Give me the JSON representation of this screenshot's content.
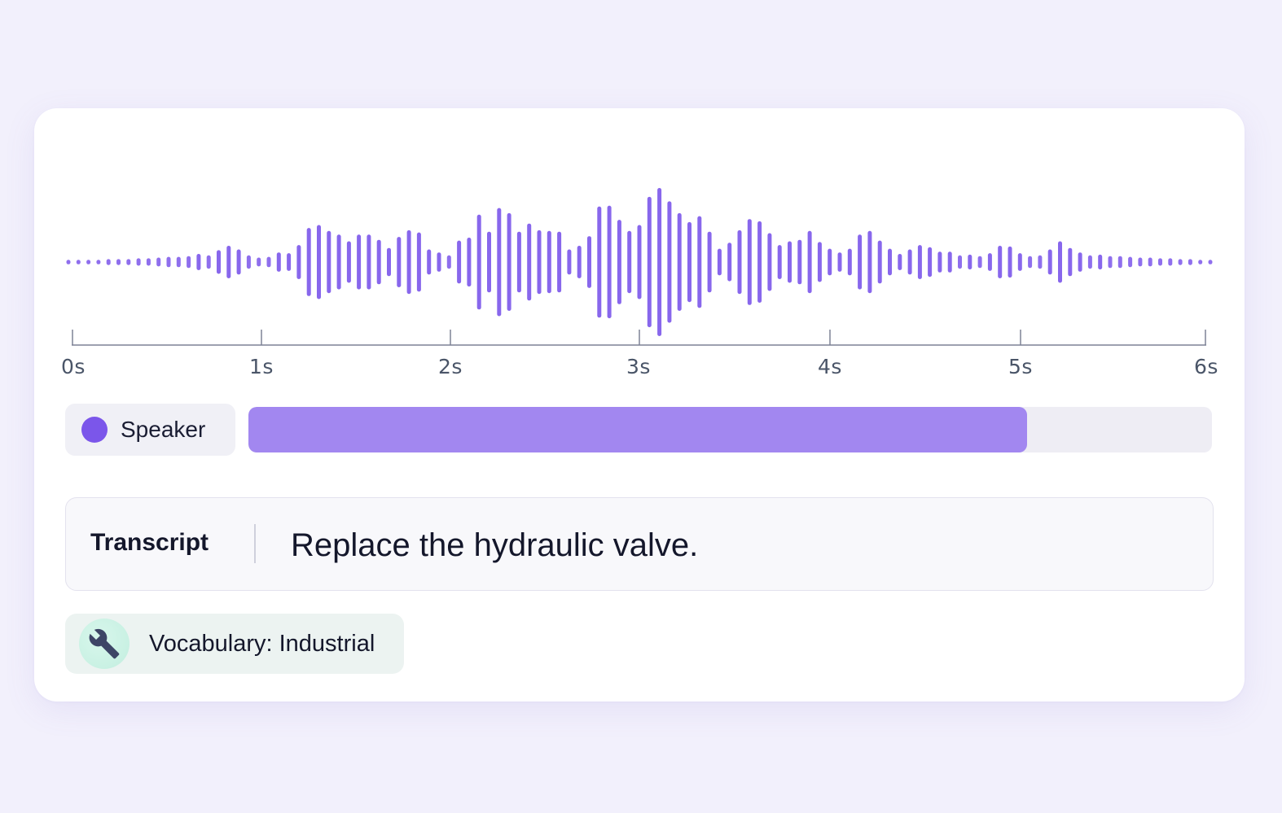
{
  "waveform": {
    "color": "#7b56ea",
    "amplitudes": [
      0.03,
      0.03,
      0.03,
      0.03,
      0.04,
      0.04,
      0.04,
      0.05,
      0.05,
      0.06,
      0.07,
      0.07,
      0.08,
      0.11,
      0.09,
      0.16,
      0.22,
      0.17,
      0.09,
      0.06,
      0.07,
      0.13,
      0.12,
      0.23,
      0.46,
      0.5,
      0.42,
      0.37,
      0.28,
      0.37,
      0.37,
      0.3,
      0.19,
      0.34,
      0.43,
      0.4,
      0.17,
      0.13,
      0.09,
      0.29,
      0.33,
      0.64,
      0.41,
      0.73,
      0.66,
      0.41,
      0.52,
      0.43,
      0.42,
      0.41,
      0.17,
      0.22,
      0.35,
      0.75,
      0.76,
      0.57,
      0.42,
      0.5,
      0.88,
      1.0,
      0.82,
      0.66,
      0.54,
      0.62,
      0.41,
      0.18,
      0.26,
      0.43,
      0.58,
      0.55,
      0.39,
      0.23,
      0.28,
      0.3,
      0.42,
      0.27,
      0.18,
      0.13,
      0.18,
      0.37,
      0.42,
      0.29,
      0.18,
      0.11,
      0.17,
      0.23,
      0.2,
      0.14,
      0.14,
      0.09,
      0.1,
      0.08,
      0.12,
      0.22,
      0.21,
      0.12,
      0.08,
      0.09,
      0.17,
      0.28,
      0.19,
      0.13,
      0.09,
      0.1,
      0.08,
      0.08,
      0.07,
      0.06,
      0.06,
      0.05,
      0.05,
      0.04,
      0.04,
      0.03,
      0.03
    ]
  },
  "timeline": {
    "ticks": [
      "0s",
      "1s",
      "2s",
      "3s",
      "4s",
      "5s",
      "6s"
    ]
  },
  "speaker": {
    "label": "Speaker",
    "color": "#7b56ea",
    "progress": 0.808
  },
  "transcript": {
    "label": "Transcript",
    "text": "Replace the hydraulic valve."
  },
  "vocabulary": {
    "label": "Vocabulary: Industrial",
    "icon": "wrench-icon"
  }
}
